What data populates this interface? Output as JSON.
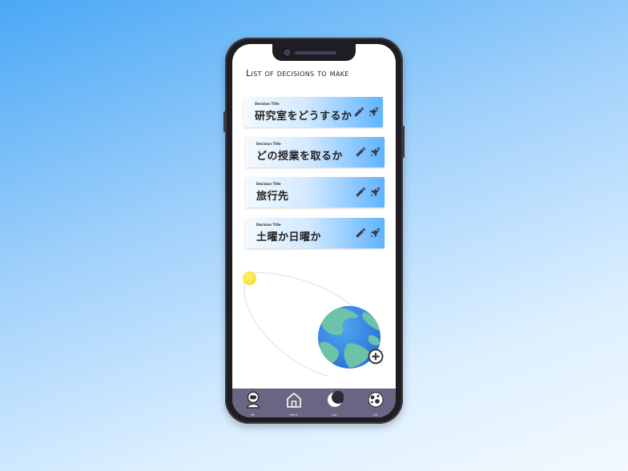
{
  "screen": {
    "title": "List of decisions to make"
  },
  "decisions": [
    {
      "caption": "Decision Title",
      "title": "研究室をどうするか"
    },
    {
      "caption": "Decision Title",
      "title": "どの授業を取るか"
    },
    {
      "caption": "Decision Title",
      "title": "旅行先"
    },
    {
      "caption": "Decision Title",
      "title": "土曜か日曜か"
    }
  ],
  "icons": {
    "edit": "pencil-icon",
    "launch": "rocket-icon",
    "add": "plus-circle-icon",
    "planet": "earth-icon",
    "sun": "sun-icon"
  },
  "tabbar": {
    "items": [
      {
        "icon": "astronaut-icon",
        "label": "Me"
      },
      {
        "icon": "home-icon",
        "label": "Home"
      },
      {
        "icon": "moon-icon",
        "label": "List"
      },
      {
        "icon": "planet-icon",
        "label": "List"
      }
    ]
  },
  "colors": {
    "tabbar_bg": "#6a6582",
    "card_gradient_end": "#5fb3ff",
    "sun": "#f3d61c"
  }
}
